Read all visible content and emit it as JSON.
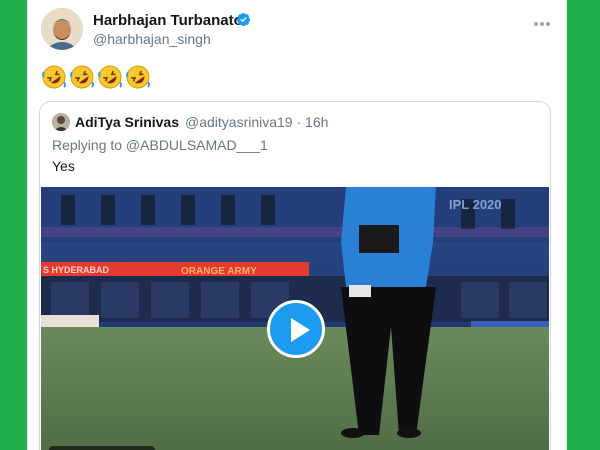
{
  "colors": {
    "page_background": "#21b04b",
    "card_background": "#ffffff",
    "accent_blue": "#1d9bf0",
    "secondary_text": "#657786",
    "primary_text": "#14171a"
  },
  "tweet": {
    "author_name": "Harbhajan Turbanator",
    "author_handle": "@harbhajan_singh",
    "verified": true,
    "icons": {
      "verified": "verified-badge-icon",
      "more": "more-options-icon",
      "emoji": "rolling-on-floor-laughing-emoji"
    },
    "text_emoji_count": 4
  },
  "quote": {
    "author_name": "AdiTya Srinivas",
    "meta": "@adityasriniva19 · 16h",
    "reply_text": "Replying to @ABDULSAMAD___1",
    "text": "Yes",
    "video": {
      "play_icon": "play-icon",
      "stadium_banners": [
        "S HYDERABAD",
        "ORANGE ARMY",
        "IPL 2020"
      ]
    }
  }
}
